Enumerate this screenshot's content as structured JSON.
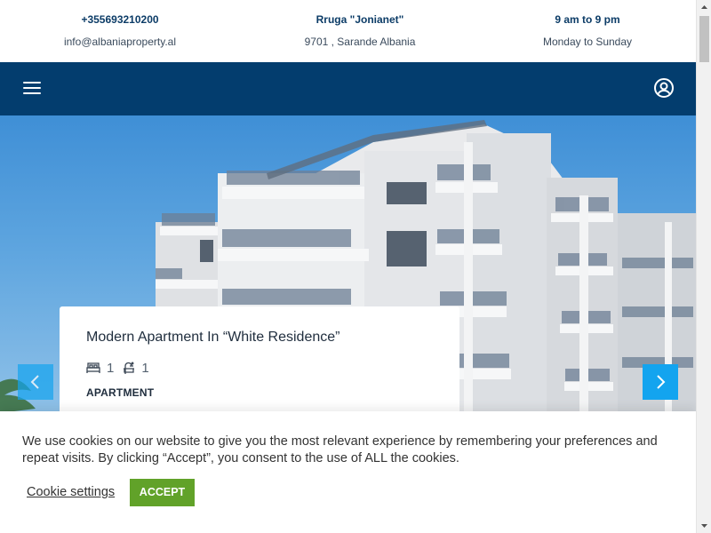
{
  "topbar": {
    "phone": "+355693210200",
    "email": "info@albaniaproperty.al",
    "street": "Rruga \"Jonianet\"",
    "city": "9701 , Sarande Albania",
    "hours": "9 am to 9 pm",
    "days": "Monday to Sunday"
  },
  "nav": {
    "menu_icon": "hamburger-menu-icon",
    "account_icon": "user-circle-icon",
    "background": "#033d6e"
  },
  "listing": {
    "title": "Modern Apartment In “White Residence”",
    "bedrooms": "1",
    "bathrooms": "1",
    "type": "APARTMENT"
  },
  "slider": {
    "prev_icon": "chevron-left-icon",
    "next_icon": "chevron-right-icon",
    "arrow_color": "#13a4ef"
  },
  "cookie": {
    "message": "We use cookies on our website to give you the most relevant experience by remembering your preferences and repeat visits. By clicking “Accept”, you consent to the use of ALL the cookies.",
    "settings_label": "Cookie settings",
    "accept_label": "ACCEPT",
    "accept_color": "#61a229"
  }
}
